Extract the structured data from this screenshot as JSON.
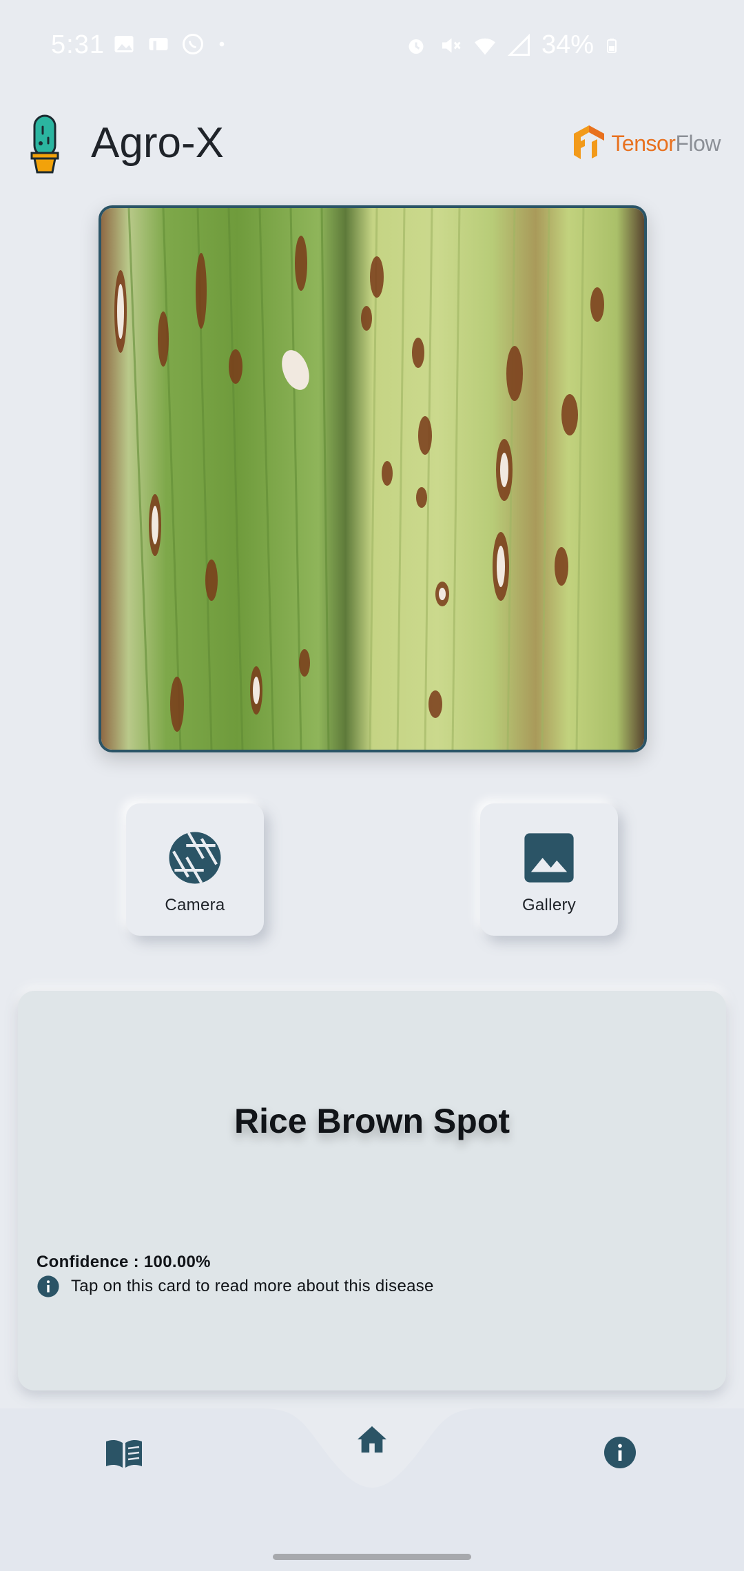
{
  "status_bar": {
    "time": "5:31",
    "battery": "34%",
    "left_icons": [
      "image-icon",
      "voicemail-icon",
      "whatsapp-icon",
      "dot-icon"
    ],
    "right_icons": [
      "alarm-icon",
      "mute-icon",
      "wifi-icon",
      "signal-icon",
      "battery-icon"
    ]
  },
  "header": {
    "title": "Agro-X",
    "brand_tensor": "Tensor",
    "brand_flow": "Flow"
  },
  "actions": {
    "camera_label": "Camera",
    "gallery_label": "Gallery"
  },
  "result": {
    "disease": "Rice Brown Spot",
    "confidence": "Confidence : 100.00%",
    "hint": "Tap on this card to read more about this disease"
  },
  "nav": {
    "items": [
      "book-icon",
      "home-icon",
      "info-icon"
    ],
    "active": "home"
  },
  "colors": {
    "accent": "#2b5466",
    "background": "#e8ebf0",
    "card": "#dfe5e8",
    "tensorflow_orange": "#e8711f"
  }
}
